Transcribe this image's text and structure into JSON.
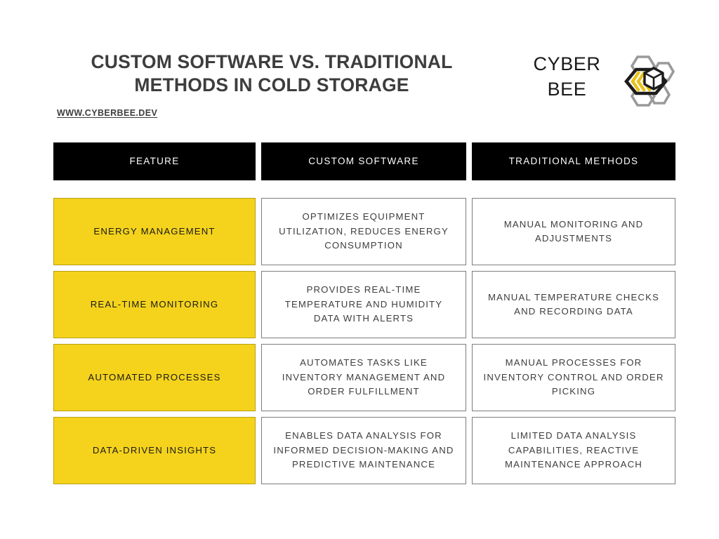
{
  "header": {
    "title": "CUSTOM SOFTWARE VS. TRADITIONAL METHODS IN COLD STORAGE",
    "site_url": "WWW.CYBERBEE.DEV",
    "brand_name": "CYBER BEE",
    "logo_icon": "hexagon-bee-logo-icon"
  },
  "colors": {
    "accent_yellow": "#F5D31C",
    "header_black": "#000000",
    "text_dark": "#3D3D3D",
    "cell_border_gray": "#7D7D7D",
    "background": "#FFFFFF"
  },
  "table": {
    "columns": [
      "FEATURE",
      "CUSTOM SOFTWARE",
      "TRADITIONAL METHODS"
    ],
    "rows": [
      {
        "feature": "ENERGY MANAGEMENT",
        "custom_software": "OPTIMIZES EQUIPMENT UTILIZATION, REDUCES ENERGY CONSUMPTION",
        "traditional_methods": "MANUAL MONITORING AND ADJUSTMENTS"
      },
      {
        "feature": "REAL-TIME MONITORING",
        "custom_software": "PROVIDES REAL-TIME TEMPERATURE AND HUMIDITY DATA WITH ALERTS",
        "traditional_methods": "MANUAL TEMPERATURE CHECKS AND RECORDING DATA"
      },
      {
        "feature": "AUTOMATED PROCESSES",
        "custom_software": "AUTOMATES TASKS LIKE INVENTORY MANAGEMENT AND ORDER FULFILLMENT",
        "traditional_methods": "MANUAL PROCESSES FOR INVENTORY CONTROL AND ORDER PICKING"
      },
      {
        "feature": "DATA-DRIVEN INSIGHTS",
        "custom_software": "ENABLES DATA ANALYSIS FOR INFORMED DECISION-MAKING AND PREDICTIVE MAINTENANCE",
        "traditional_methods": "LIMITED DATA ANALYSIS CAPABILITIES, REACTIVE MAINTENANCE APPROACH"
      }
    ]
  }
}
